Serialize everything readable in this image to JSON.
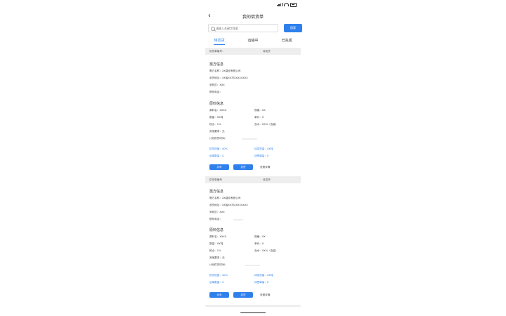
{
  "nav": {
    "back_icon": "chevron-left-icon",
    "title": "我的供货单"
  },
  "search": {
    "placeholder": "请输入关键字搜索",
    "button": "搜索"
  },
  "tabs": [
    "待发货",
    "运输中",
    "已完成"
  ],
  "orders": [
    {
      "header_left": "供货单编号：",
      "header_right": "待发货",
      "buyer_title": "需方信息",
      "buyer_lines": [
        "需方名称：XX建设有限公司",
        "收货地址：XX省XX市XXXXXXXX",
        "采购员：XXX",
        "联系电话："
      ],
      "material_title": "原料信息",
      "mat_left": [
        "原料名：XXXX",
        "数量：XX吨",
        "税点：1%",
        "其他要求：无",
        "计划供货时间："
      ],
      "mat_right": [
        "规格：XX",
        "单价：X",
        "含水：XX%（含量）"
      ],
      "stat_left": [
        "供货进度：40%",
        "运单数量：4"
      ],
      "stat_right": [
        "待发货量：XX吨",
        "待签单量：0"
      ],
      "actions": [
        "派车",
        "发货",
        "查看详情"
      ]
    },
    {
      "header_left": "供货单编号",
      "header_right": "待发货",
      "buyer_title": "需方信息",
      "buyer_lines": [
        "需方名称：XX建设有限公司",
        "收货地址：XX省XX市XXXXXXXX",
        "采购员：XXX",
        "联系电话："
      ],
      "material_title": "原料信息",
      "mat_left": [
        "原料名：XXXX",
        "数量：XX吨",
        "税点：1%",
        "其他要求：无",
        "计划供货时间："
      ],
      "mat_right": [
        "规格：XX",
        "单价：X",
        "含水：XX%（含量）"
      ],
      "stat_left": [
        "供货进度：40%",
        "运单数量：4"
      ],
      "stat_right": [
        "待发货量：XX吨",
        "待签单量：0"
      ],
      "actions": [
        "派车",
        "发货",
        "查看详情"
      ]
    }
  ],
  "colors": {
    "accent": "#2f80ed",
    "header_bg": "#eeeeee"
  }
}
